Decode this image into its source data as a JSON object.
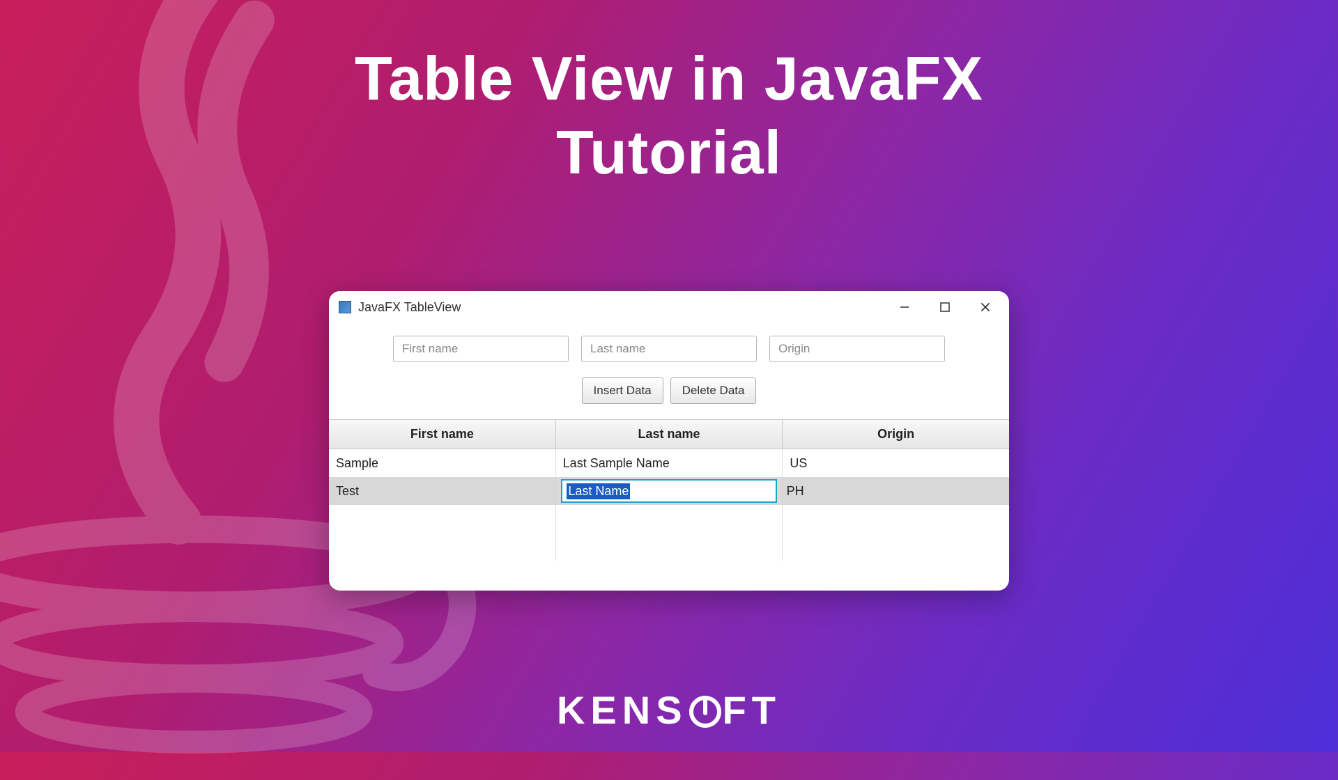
{
  "title_line1": "Table View in JavaFX",
  "title_line2": "Tutorial",
  "window": {
    "title": "JavaFX TableView"
  },
  "inputs": {
    "first_name_placeholder": "First name",
    "last_name_placeholder": "Last name",
    "origin_placeholder": "Origin"
  },
  "buttons": {
    "insert": "Insert Data",
    "delete": "Delete Data"
  },
  "table": {
    "headers": {
      "first_name": "First name",
      "last_name": "Last name",
      "origin": "Origin"
    },
    "rows": [
      {
        "first_name": "Sample",
        "last_name": "Last Sample Name",
        "origin": "US"
      },
      {
        "first_name": "Test",
        "last_name": "Last Name",
        "origin": "PH"
      }
    ],
    "editing_cell_value": "Last Name"
  },
  "brand": "KENSOFT"
}
